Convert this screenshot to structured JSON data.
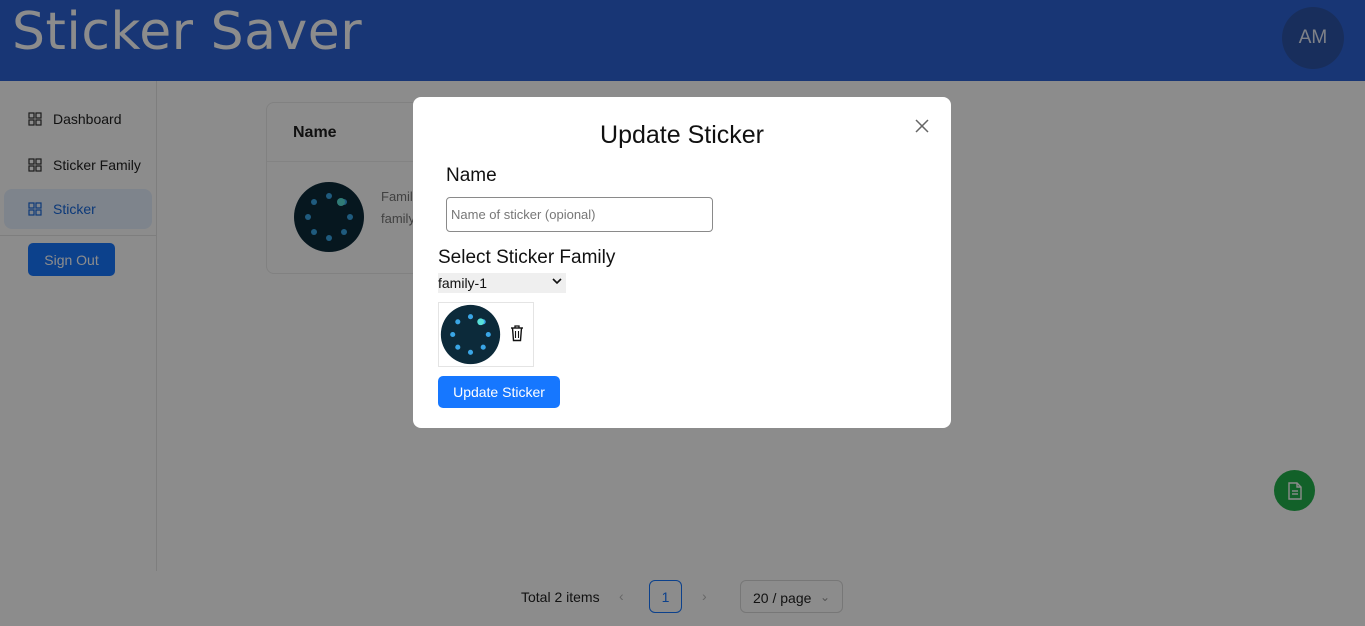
{
  "header": {
    "app_title": "Sticker Saver",
    "avatar_initials": "AM"
  },
  "sidebar": {
    "items": [
      {
        "label": "Dashboard",
        "icon": "grid-icon",
        "active": false
      },
      {
        "label": "Sticker Family",
        "icon": "grid-icon",
        "active": false
      },
      {
        "label": "Sticker",
        "icon": "grid-icon",
        "active": true
      }
    ],
    "signout_label": "Sign Out"
  },
  "table": {
    "headers": [
      "Name"
    ],
    "rows": [
      {
        "image": "sticker-thumbnail",
        "family_text": [
          "Famil",
          "family"
        ]
      }
    ]
  },
  "pagination": {
    "total_text": "Total 2 items",
    "current_page": "1",
    "page_size": "20 / page"
  },
  "fab": {
    "icon": "document-icon",
    "color": "#22b14c"
  },
  "modal": {
    "title": "Update Sticker",
    "name_label": "Name",
    "name_value": "",
    "name_placeholder": "Name of sticker (opional)",
    "family_label": "Select Sticker Family",
    "family_selected": "family-1",
    "update_button": "Update Sticker"
  },
  "colors": {
    "header": "#2c63d6",
    "primary": "#1677ff",
    "active_bg": "#e6f0ff"
  }
}
